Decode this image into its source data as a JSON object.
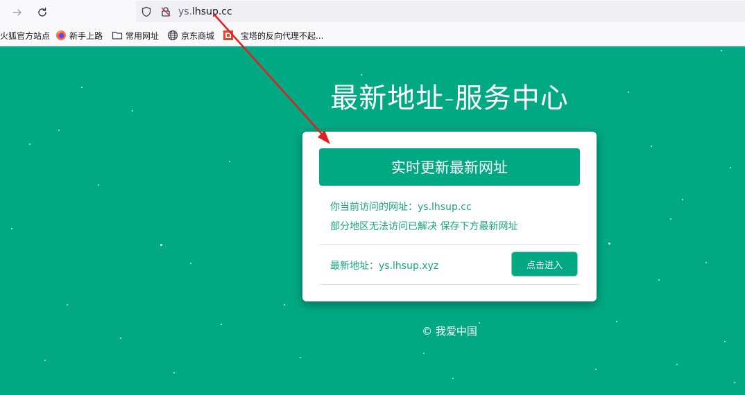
{
  "browser": {
    "url_prefix": "ys.",
    "url_domain": "lhsup.cc",
    "bookmarks": [
      {
        "label": "火狐官方站点",
        "icon": "none"
      },
      {
        "label": "新手上路",
        "icon": "firefox-icon"
      },
      {
        "label": "常用网址",
        "icon": "folder-icon"
      },
      {
        "label": "京东商城",
        "icon": "globe-icon"
      },
      {
        "label": "宝塔的反向代理不起...",
        "icon": "bt-icon"
      }
    ]
  },
  "page": {
    "title": "最新地址-服务中心",
    "update_button": "实时更新最新网址",
    "current_url_line": "你当前访问的网址：ys.lhsup.cc",
    "notice_line": "部分地区无法访问已解决 保存下方最新网址",
    "latest_label": "最新地址：ys.lhsup.xyz",
    "enter_button": "点击进入",
    "footer": "© 我爱中国"
  },
  "colors": {
    "background": "#00a884",
    "accent_text": "#1aa37f",
    "annotation_arrow": "#e02020"
  }
}
